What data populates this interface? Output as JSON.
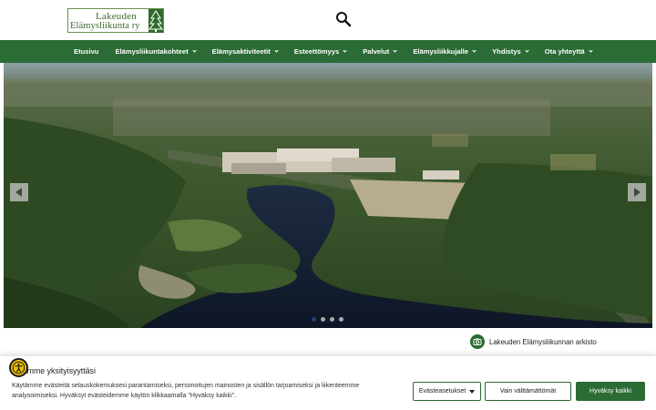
{
  "logo": {
    "line1": "Lakeuden",
    "line2": "Elämysliikunta ry"
  },
  "search": {
    "icon": "search-icon"
  },
  "nav": {
    "items": [
      {
        "label": "Etusivu",
        "dropdown": false
      },
      {
        "label": "Elämysliikuntakohteet",
        "dropdown": true
      },
      {
        "label": "Elämysaktiviteetit",
        "dropdown": true
      },
      {
        "label": "Esteettömyys",
        "dropdown": true
      },
      {
        "label": "Palvelut",
        "dropdown": true
      },
      {
        "label": "Elämysliikkujalle",
        "dropdown": true
      },
      {
        "label": "Yhdistys",
        "dropdown": true
      },
      {
        "label": "Ota yhteyttä",
        "dropdown": true
      }
    ]
  },
  "slider": {
    "slide_count": 4,
    "active_slide": 1
  },
  "credit": {
    "icon": "camera-icon",
    "label": "Lakeuden Elämysliikunnan arkisto"
  },
  "cookie": {
    "title": "ostamme yksityisyyttäsi",
    "text": "Käytämme evästeitä selauskokemuksesi parantamiseksi, personoitujen mainosten ja sisällön tarjoamiseksi ja liikenteemme analysoimiseksi. Hyväksyt evästeidemme käytön klikkaamalla \"Hyväksy kaikki\".",
    "settings_label": "Evästeasetukset",
    "necessary_label": "Vain välttämättömät",
    "accept_label": "Hyväksy kaikki"
  },
  "colors": {
    "brand_green": "#2b6b35",
    "accessibility_yellow": "#f2c200"
  }
}
